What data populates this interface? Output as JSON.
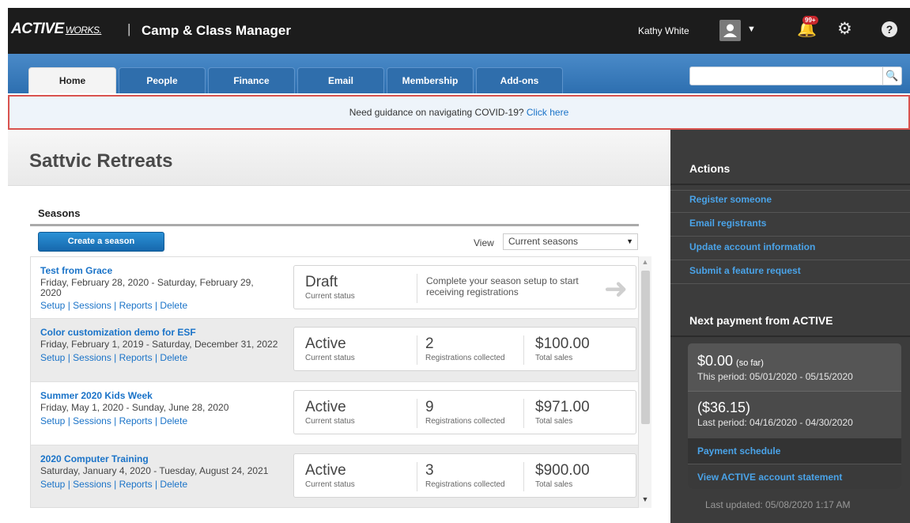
{
  "header": {
    "logo": "ACTIVE",
    "logo_suffix": "WORKS.",
    "separator": "|",
    "app_title": "Camp & Class Manager",
    "user_name": "Kathy White",
    "notification_badge": "99+"
  },
  "nav": {
    "tabs": [
      {
        "label": "Home"
      },
      {
        "label": "People"
      },
      {
        "label": "Finance"
      },
      {
        "label": "Email"
      },
      {
        "label": "Membership"
      },
      {
        "label": "Add-ons"
      }
    ],
    "search_placeholder": ""
  },
  "banner": {
    "text": "Need guidance on navigating COVID-19?",
    "link": "Click here"
  },
  "page": {
    "title": "Sattvic Retreats"
  },
  "seasons": {
    "title": "Seasons",
    "create_button": "Create a season",
    "view_label": "View",
    "view_value": "Current seasons",
    "items": [
      {
        "name": "Test from Grace",
        "dates": "Friday, February 28, 2020 - Saturday, February 29, 2020",
        "links": "Setup | Sessions | Reports | Delete",
        "status": "Draft",
        "status_label": "Current status",
        "message": "Complete your season setup to start receiving registrations"
      },
      {
        "name": "Color customization demo for ESF",
        "dates": "Friday, February 1, 2019 - Saturday, December 31, 2022",
        "links": "Setup | Sessions | Reports | Delete",
        "status": "Active",
        "status_label": "Current status",
        "registrations": "2",
        "registrations_label": "Registrations collected",
        "sales": "$100.00",
        "sales_label": "Total sales"
      },
      {
        "name": "Summer 2020 Kids Week",
        "dates": "Friday, May 1, 2020 - Sunday, June 28, 2020",
        "links": "Setup | Sessions | Reports | Delete",
        "status": "Active",
        "status_label": "Current status",
        "registrations": "9",
        "registrations_label": "Registrations collected",
        "sales": "$971.00",
        "sales_label": "Total sales"
      },
      {
        "name": "2020 Computer Training",
        "dates": "Saturday, January 4, 2020 - Tuesday, August 24, 2021",
        "links": "Setup | Sessions | Reports | Delete",
        "status": "Active",
        "status_label": "Current status",
        "registrations": "3",
        "registrations_label": "Registrations collected",
        "sales": "$900.00",
        "sales_label": "Total sales"
      }
    ]
  },
  "sidebar": {
    "actions_title": "Actions",
    "actions": [
      {
        "label": "Register someone"
      },
      {
        "label": "Email registrants"
      },
      {
        "label": "Update account information"
      },
      {
        "label": "Submit a feature request"
      }
    ],
    "payment_title": "Next payment from ACTIVE",
    "current_amount": "$0.00",
    "current_suffix": "(so far)",
    "current_period": "This period: 05/01/2020 - 05/15/2020",
    "last_amount": "($36.15)",
    "last_period": "Last period: 04/16/2020 - 04/30/2020",
    "payment_schedule": "Payment schedule",
    "statement": "View ACTIVE account statement",
    "last_updated": "Last updated: 05/08/2020 1:17 AM"
  },
  "colors": {
    "topbar": "#1c1c1c",
    "nav_blue": "#2d6fb0",
    "link_blue": "#1a73c8",
    "banner_border": "#d9534f",
    "sidebar": "#3c3c3c"
  }
}
